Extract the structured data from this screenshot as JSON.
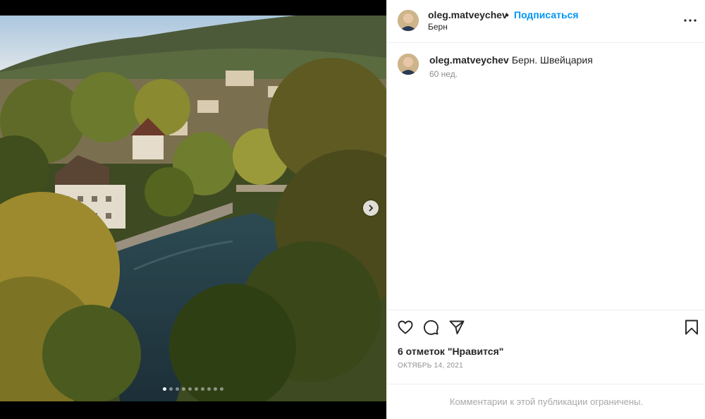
{
  "post": {
    "username": "oleg.matveychev",
    "separator": "•",
    "follow_label": "Подписаться",
    "location": "Берн",
    "caption_text": "Берн. Швейцария",
    "caption_time": "60 нед.",
    "likes_text": "6 отметок \"Нравится\"",
    "date": "ОКТЯБРЬ 14, 2021",
    "comments_restricted": "Комментарии к этой публикации ограничены."
  },
  "carousel": {
    "total_slides": 10,
    "active_index": 0
  },
  "icons": {
    "more": "more-options-icon",
    "like": "heart-icon",
    "comment": "comment-icon",
    "share": "share-icon",
    "save": "bookmark-icon",
    "next": "chevron-right-icon"
  },
  "colors": {
    "link": "#0095f6",
    "text": "#262626",
    "secondary": "#8e8e8e",
    "border": "#efefef"
  }
}
